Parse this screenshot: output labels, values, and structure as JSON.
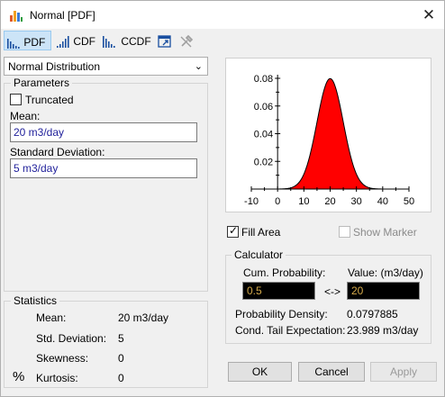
{
  "window": {
    "title": "Normal [PDF]"
  },
  "toolbar": {
    "pdf_label": "PDF",
    "cdf_label": "CDF",
    "ccdf_label": "CCDF"
  },
  "distribution": {
    "selected": "Normal Distribution"
  },
  "parameters": {
    "group_label": "Parameters",
    "truncated_label": "Truncated",
    "truncated_checked": false,
    "mean_label": "Mean:",
    "mean_value": "20 m3/day",
    "sd_label": "Standard Deviation:",
    "sd_value": "5 m3/day"
  },
  "statistics": {
    "group_label": "Statistics",
    "percent_symbol": "%",
    "rows": [
      {
        "label": "Mean:",
        "value": "20 m3/day"
      },
      {
        "label": "Std. Deviation:",
        "value": "5"
      },
      {
        "label": "Skewness:",
        "value": "0"
      },
      {
        "label": "Kurtosis:",
        "value": "0"
      }
    ]
  },
  "chart_options": {
    "fill_area_label": "Fill Area",
    "fill_area_checked": true,
    "show_marker_label": "Show Marker",
    "show_marker_checked": false
  },
  "calculator": {
    "group_label": "Calculator",
    "cum_prob_label": "Cum. Probability:",
    "value_label": "Value: (m3/day)",
    "cum_prob_value": "0.5",
    "arrow_label": "<->",
    "value_value": "20",
    "density_label": "Probability Density:",
    "density_value": "0.0797885",
    "tail_label": "Cond. Tail Expectation:",
    "tail_value": "23.989 m3/day"
  },
  "buttons": {
    "ok": "OK",
    "cancel": "Cancel",
    "apply": "Apply"
  },
  "colors": {
    "fill": "#ff0000",
    "selected_tab_bg": "#cce4f7",
    "input_text": "#1f1f9a",
    "calc_text": "#d4a94a"
  },
  "chart_data": {
    "type": "area",
    "distribution": "normal",
    "mean": 20,
    "sd": 5,
    "xlim": [
      -10,
      50
    ],
    "ylim": [
      0,
      0.08
    ],
    "x_ticks": [
      "-10",
      "0",
      "10",
      "20",
      "30",
      "40",
      "50"
    ],
    "y_ticks": [
      "0.02",
      "0.04",
      "0.06",
      "0.08"
    ],
    "fill_color": "#ff0000",
    "grid": false
  }
}
